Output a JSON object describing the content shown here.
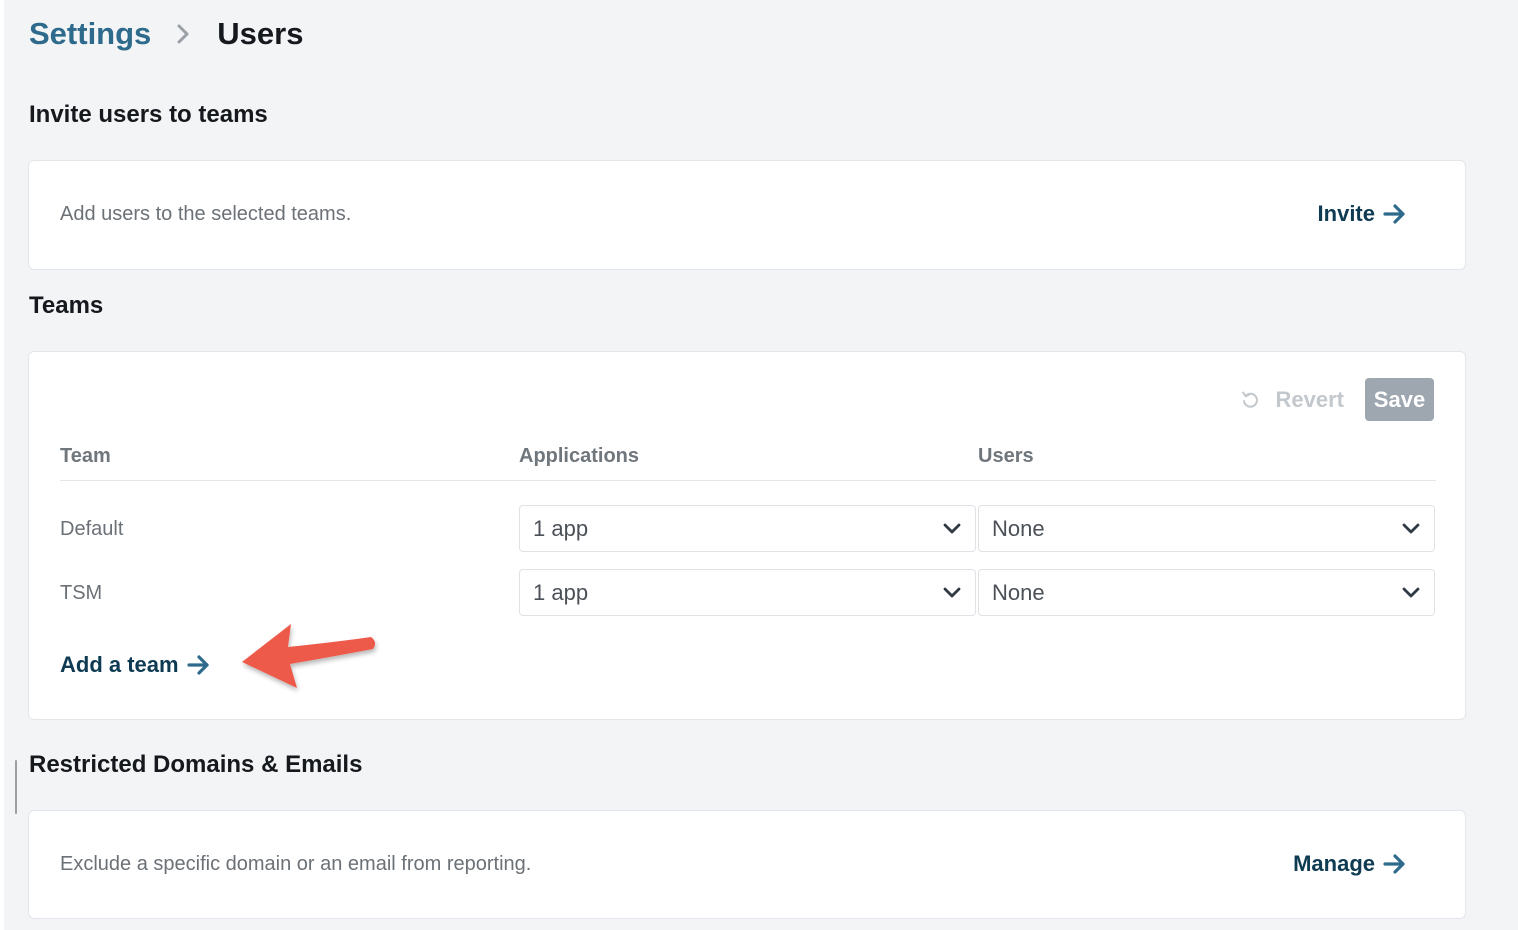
{
  "breadcrumb": {
    "parent": "Settings",
    "current": "Users"
  },
  "invite_section": {
    "title": "Invite users to teams",
    "description": "Add users to the selected teams.",
    "action_label": "Invite"
  },
  "teams_section": {
    "title": "Teams",
    "revert_label": "Revert",
    "save_label": "Save",
    "columns": [
      "Team",
      "Applications",
      "Users"
    ],
    "rows": [
      {
        "team": "Default",
        "applications": "1 app",
        "users": "None"
      },
      {
        "team": "TSM",
        "applications": "1 app",
        "users": "None"
      }
    ],
    "add_team_label": "Add a team"
  },
  "restricted_section": {
    "title": "Restricted Domains & Emails",
    "description": "Exclude a specific domain or an email from reporting.",
    "action_label": "Manage"
  },
  "icons": {
    "breadcrumb_separator": "chevron-right-icon",
    "action_arrow": "arrow-right-icon",
    "revert": "undo-icon",
    "dropdown": "chevron-down-icon",
    "annotation": "red-pointer-arrow"
  },
  "colors": {
    "background": "#f3f4f6",
    "link": "#2d6a8c",
    "action_text": "#0e3a52",
    "save_button_disabled": "#9ea7af",
    "annotation_arrow": "#ee5a4a"
  }
}
